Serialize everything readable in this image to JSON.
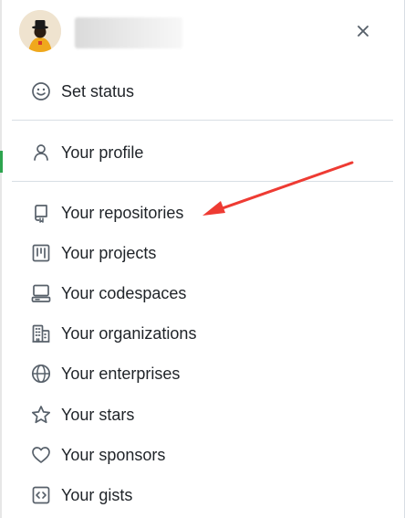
{
  "header": {
    "username": "username"
  },
  "menu": {
    "status": {
      "label": "Set status",
      "icon": "smiley-icon"
    },
    "profile": {
      "label": "Your profile",
      "icon": "person-icon"
    },
    "items": [
      {
        "label": "Your repositories",
        "icon": "repo-icon"
      },
      {
        "label": "Your projects",
        "icon": "project-icon"
      },
      {
        "label": "Your codespaces",
        "icon": "codespaces-icon"
      },
      {
        "label": "Your organizations",
        "icon": "organization-icon"
      },
      {
        "label": "Your enterprises",
        "icon": "globe-icon"
      },
      {
        "label": "Your stars",
        "icon": "star-icon"
      },
      {
        "label": "Your sponsors",
        "icon": "heart-icon"
      },
      {
        "label": "Your gists",
        "icon": "code-square-icon"
      }
    ]
  },
  "colors": {
    "text": "#1f2328",
    "icon": "#57606a",
    "divider": "#d8dee4",
    "annotation": "#ee3b33",
    "accent": "#2da44e"
  }
}
